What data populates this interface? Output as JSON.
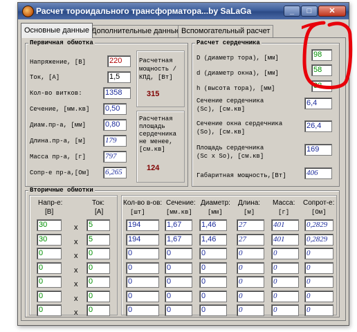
{
  "window": {
    "title": "Расчет тороидального трансформатора...by SaLaGa",
    "minimize_glyph": "_",
    "maximize_glyph": "□",
    "close_glyph": "✕"
  },
  "tabs": [
    {
      "label": "Основные данные"
    },
    {
      "label": "Дополнительные данные"
    },
    {
      "label": "Вспомогательный расчет"
    }
  ],
  "primary": {
    "title": "Первичная обмотка",
    "voltage": {
      "label": "Напряжение, [В]",
      "value": "220"
    },
    "current": {
      "label": "Ток, [А]",
      "value": "1,5"
    },
    "turns": {
      "label": "Кол-во витков:",
      "value": "1358"
    },
    "section": {
      "label": "Сечение, [мм.кв]",
      "value": "0,50"
    },
    "wire_diam": {
      "label": "Диам.пр-а, [мм]",
      "value": "0,80"
    },
    "wire_len": {
      "label": "Длина.пр-а, [м]",
      "value": "179"
    },
    "wire_mass": {
      "label": "Масса пр-а, [г]",
      "value": "797"
    },
    "wire_res": {
      "label": "Сопр-е пр-а,[Ом]",
      "value": "6,265"
    },
    "power_box": {
      "label": "Расчетная мощность /КПД, [Вт]",
      "value": "315"
    },
    "area_box": {
      "label": "Расчетная площадь сердечника не менее, [см.кв]",
      "value": "124"
    }
  },
  "core": {
    "title": "Расчет сердечника",
    "D": {
      "label": "D (диаметр тора), [мм]",
      "value": "98"
    },
    "d": {
      "label": "d (диаметр окна), [мм]",
      "value": "58"
    },
    "h": {
      "label": "h (высота тора), [мм]",
      "value": "32"
    },
    "sc": {
      "label1": "Сечение сердечника",
      "label2": "(Sc), [см.кв]",
      "value": "6,4"
    },
    "so": {
      "label1": "Сечение окна сердечника",
      "label2": "(So), [см.кв]",
      "value": "26,4"
    },
    "scso": {
      "label1": "Площадь сердечника",
      "label2": "(Sc x So), [см.кв]",
      "value": "169"
    },
    "gab": {
      "label": "Габаритная мощность,[Вт]",
      "value": "406"
    }
  },
  "secondary": {
    "title": "Вторичные обмотки",
    "headers": {
      "voltage": "Напр-е:",
      "voltage_unit": "[В]",
      "current": "Ток:",
      "current_unit": "[А]",
      "turns": "Кол-во в-ов:",
      "turns_unit": "[шт]",
      "section": "Сечение:",
      "section_unit": "[мм.кв]",
      "diam": "Диаметр:",
      "diam_unit": "[мм]",
      "len": "Длина:",
      "len_unit": "[м]",
      "mass": "Масса:",
      "mass_unit": "[г]",
      "res": "Сопрот-е:",
      "res_unit": "[Ом]"
    },
    "times_sign": "x",
    "rows": [
      {
        "u": "30",
        "i": "5",
        "n": "194",
        "s": "1,67",
        "d": "1,46",
        "l": "27",
        "m": "401",
        "r": "0,2829"
      },
      {
        "u": "30",
        "i": "5",
        "n": "194",
        "s": "1,67",
        "d": "1,46",
        "l": "27",
        "m": "401",
        "r": "0,2829"
      },
      {
        "u": "0",
        "i": "0",
        "n": "0",
        "s": "0",
        "d": "0",
        "l": "0",
        "m": "0",
        "r": "0"
      },
      {
        "u": "0",
        "i": "0",
        "n": "0",
        "s": "0",
        "d": "0",
        "l": "0",
        "m": "0",
        "r": "0"
      },
      {
        "u": "0",
        "i": "0",
        "n": "0",
        "s": "0",
        "d": "0",
        "l": "0",
        "m": "0",
        "r": "0"
      },
      {
        "u": "0",
        "i": "0",
        "n": "0",
        "s": "0",
        "d": "0",
        "l": "0",
        "m": "0",
        "r": "0"
      },
      {
        "u": "0",
        "i": "0",
        "n": "0",
        "s": "0",
        "d": "0",
        "l": "0",
        "m": "0",
        "r": "0"
      }
    ]
  },
  "colors": {
    "input_green": "#009000",
    "result_red": "#800000",
    "annotation_red": "#e8000a"
  }
}
